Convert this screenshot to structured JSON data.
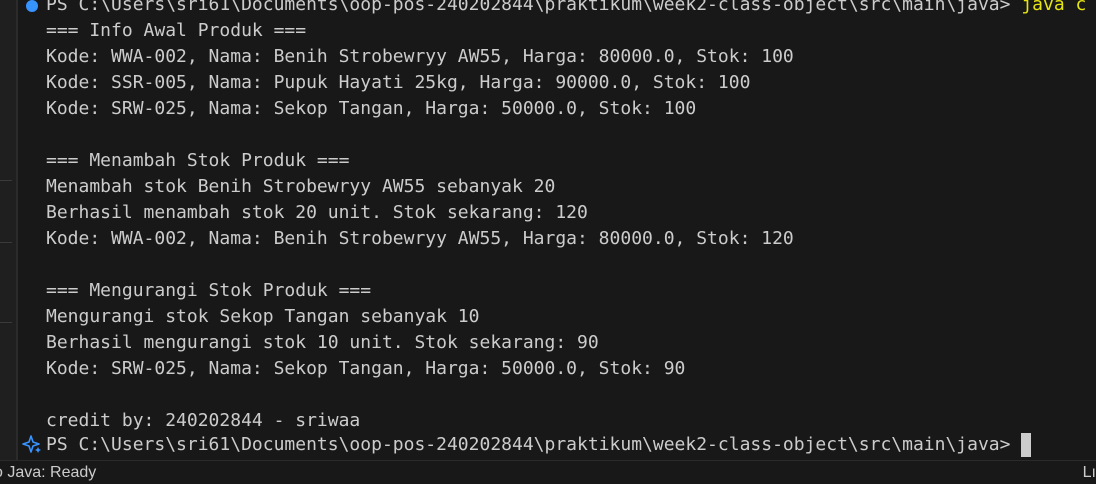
{
  "terminal": {
    "top_prompt": {
      "path": "PS C:\\Users\\sri61\\Documents\\oop-pos-240202844\\praktikum\\week2-class-object\\src\\main\\java>",
      "command": "java c"
    },
    "output": [
      "=== Info Awal Produk ===",
      "Kode: WWA-002, Nama: Benih Strobewryy AW55, Harga: 80000.0, Stok: 100",
      "Kode: SSR-005, Nama: Pupuk Hayati 25kg, Harga: 90000.0, Stok: 100",
      "Kode: SRW-025, Nama: Sekop Tangan, Harga: 50000.0, Stok: 100",
      "",
      "=== Menambah Stok Produk ===",
      "Menambah stok Benih Strobewryy AW55 sebanyak 20",
      "Berhasil menambah stok 20 unit. Stok sekarang: 120",
      "Kode: WWA-002, Nama: Benih Strobewryy AW55, Harga: 80000.0, Stok: 120",
      "",
      "=== Mengurangi Stok Produk ===",
      "Mengurangi stok Sekop Tangan sebanyak 10",
      "Berhasil mengurangi stok 10 unit. Stok sekarang: 90",
      "Kode: SRW-025, Nama: Sekop Tangan, Harga: 50000.0, Stok: 90",
      "",
      "credit by: 240202844 - sriwaa"
    ],
    "bottom_prompt": {
      "path": "PS C:\\Users\\sri61\\Documents\\oop-pos-240202844\\praktikum\\week2-class-object\\src\\main\\java>"
    }
  },
  "status_bar": {
    "left_text": "o Java: Ready",
    "right_text": "Lı"
  },
  "colors": {
    "background": "#181818",
    "text": "#cccccc",
    "command": "#e5e510",
    "accent": "#3794ff"
  }
}
